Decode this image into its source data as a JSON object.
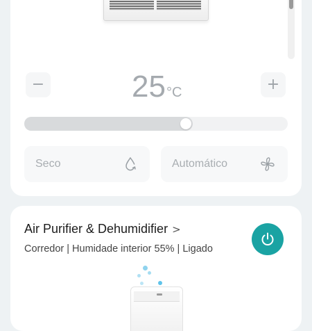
{
  "ac": {
    "temperature": "25",
    "temperature_unit": "°C",
    "minus_label": "−",
    "plus_label": "+",
    "slider_level": 0.64,
    "modes": [
      {
        "label": "Seco",
        "icon": "droplet-icon"
      },
      {
        "label": "Automático",
        "icon": "fan-icon"
      }
    ]
  },
  "purifier": {
    "name": "Air Purifier & Dehumidifier",
    "chevron": ">",
    "status": "Corredor | Humidade interior 55% | Ligado",
    "power_icon": "power-icon"
  },
  "colors": {
    "accent": "#1aa3a3",
    "background": "#eef2f4",
    "card": "#ffffff",
    "muted_text": "#a8adb1"
  }
}
